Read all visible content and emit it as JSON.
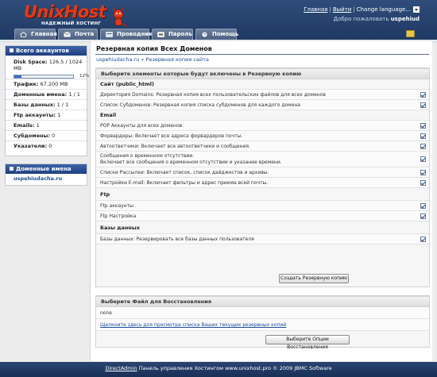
{
  "header": {
    "logo_text": "UnixHost",
    "logo_sub": "НАДЕЖНЫЙ ХОСТИНГ",
    "links": {
      "main": "Главная",
      "logout": "Выйти",
      "change_language": "Change language..."
    },
    "welcome_prefix": "Добро пожаловать",
    "username": "uspehiud"
  },
  "nav": {
    "tabs": [
      {
        "label": "Главная",
        "icon": "home-icon"
      },
      {
        "label": "Почта",
        "icon": "mail-icon"
      },
      {
        "label": "Проводник",
        "icon": "file-manager-icon"
      },
      {
        "label": "Пароль",
        "icon": "password-icon"
      },
      {
        "label": "Помощь",
        "icon": "help-icon"
      }
    ]
  },
  "sidebar": {
    "accounts_title": "Всего аккаунтов",
    "disk_label": "Disk Space:",
    "disk_value": "126.5 / 1024 MB",
    "disk_percent_text": "12%",
    "disk_fraction": 0.12,
    "stats": [
      {
        "label": "Трафик:",
        "value": "67.200 MB"
      },
      {
        "label": "Доменные имена:",
        "value": "1 / 1"
      },
      {
        "label": "Базы данных:",
        "value": "1 / 1"
      },
      {
        "label": "Ftp аккаунты:",
        "value": "1"
      },
      {
        "label": "Emails:",
        "value": "1"
      },
      {
        "label": "Субдомены:",
        "value": "0"
      },
      {
        "label": "Указатели:",
        "value": "0"
      }
    ],
    "domains_title": "Доменные имена",
    "domain": "uspehiudacha.ru"
  },
  "main": {
    "title": "Резервная копия Всех Доменов",
    "breadcrumb": "uspehiudacha.ru » Резервная копия сайта",
    "backup_panel": {
      "header": "Выберите элементы которые будут включены в Резервную копию",
      "sections": [
        {
          "title": "Сайт (public_html)",
          "options": [
            "Директория Domains: Резервная копия всех пользовательских файлов для всех доменов",
            "Список Субдоменов: Резервная копия списка субдоменов для каждого домена"
          ]
        },
        {
          "title": "Email",
          "options": [
            "POP Аккаунты для всех доменов",
            "Форвардеры: Включает все адреса форвардеров почты.",
            "Автоответчики: Включает все автоответчики и сообщения.",
            "Сообщения о временном отсутствии.",
            "Списки Рассылки: Включает список, список дайджестов и архивы.",
            "Настройки E-mail: Включает фильтры и адрес приема всей почты."
          ],
          "tall_option_line2": "Включает все сообщения о временном отсутствии и указание времени."
        },
        {
          "title": "Ftp",
          "options": [
            "Ftp аккаунты",
            "Ftp Настройка"
          ]
        },
        {
          "title": "Базы данных",
          "options": [
            "Базы данных: Резервировать все базы данных пользователя"
          ]
        }
      ],
      "button": "Создать Резервную копию"
    },
    "restore_panel": {
      "header": "Выберите Файл для Восстановления",
      "none_text": "none",
      "link": "Щелкните здесь для просмотра списка Ваших текущих резервных копий",
      "button": "Выберите Опции Восстановления"
    }
  },
  "footer": {
    "link": "DirectAdmin",
    "text": "Панель управления Хостингом www.unixhost.pro © 2009 JBMC Software"
  },
  "colors": {
    "header_bg": "#1f3962",
    "accent": "#e23b1a",
    "link": "#1a4d9c"
  }
}
